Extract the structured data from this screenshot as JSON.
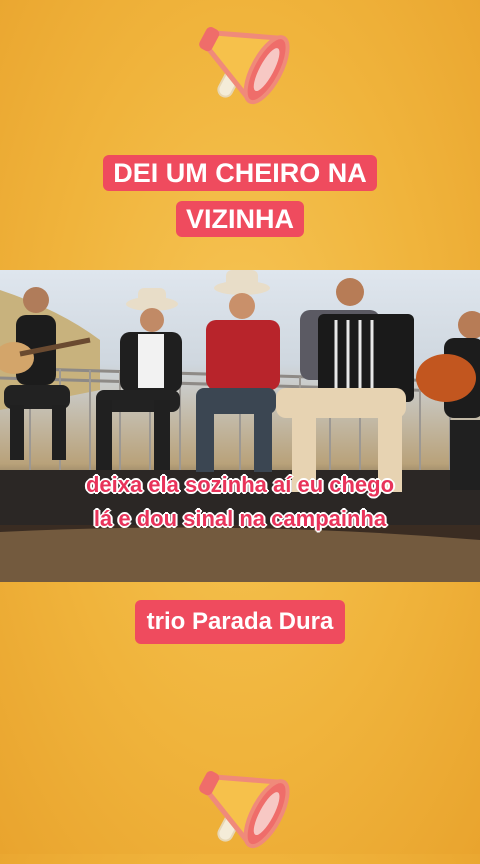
{
  "title": "DEI UM CHEIRO NA VIZINHA",
  "caption": "deixa ela sozinha aí eu chego lá e dou sinal na campainha",
  "artist": "trio Parada Dura",
  "icons": {
    "top": "megaphone-icon",
    "bottom": "megaphone-icon"
  },
  "colors": {
    "background": "#f0b43c",
    "highlight": "#ef4b5e",
    "caption_text": "#e8335a"
  }
}
